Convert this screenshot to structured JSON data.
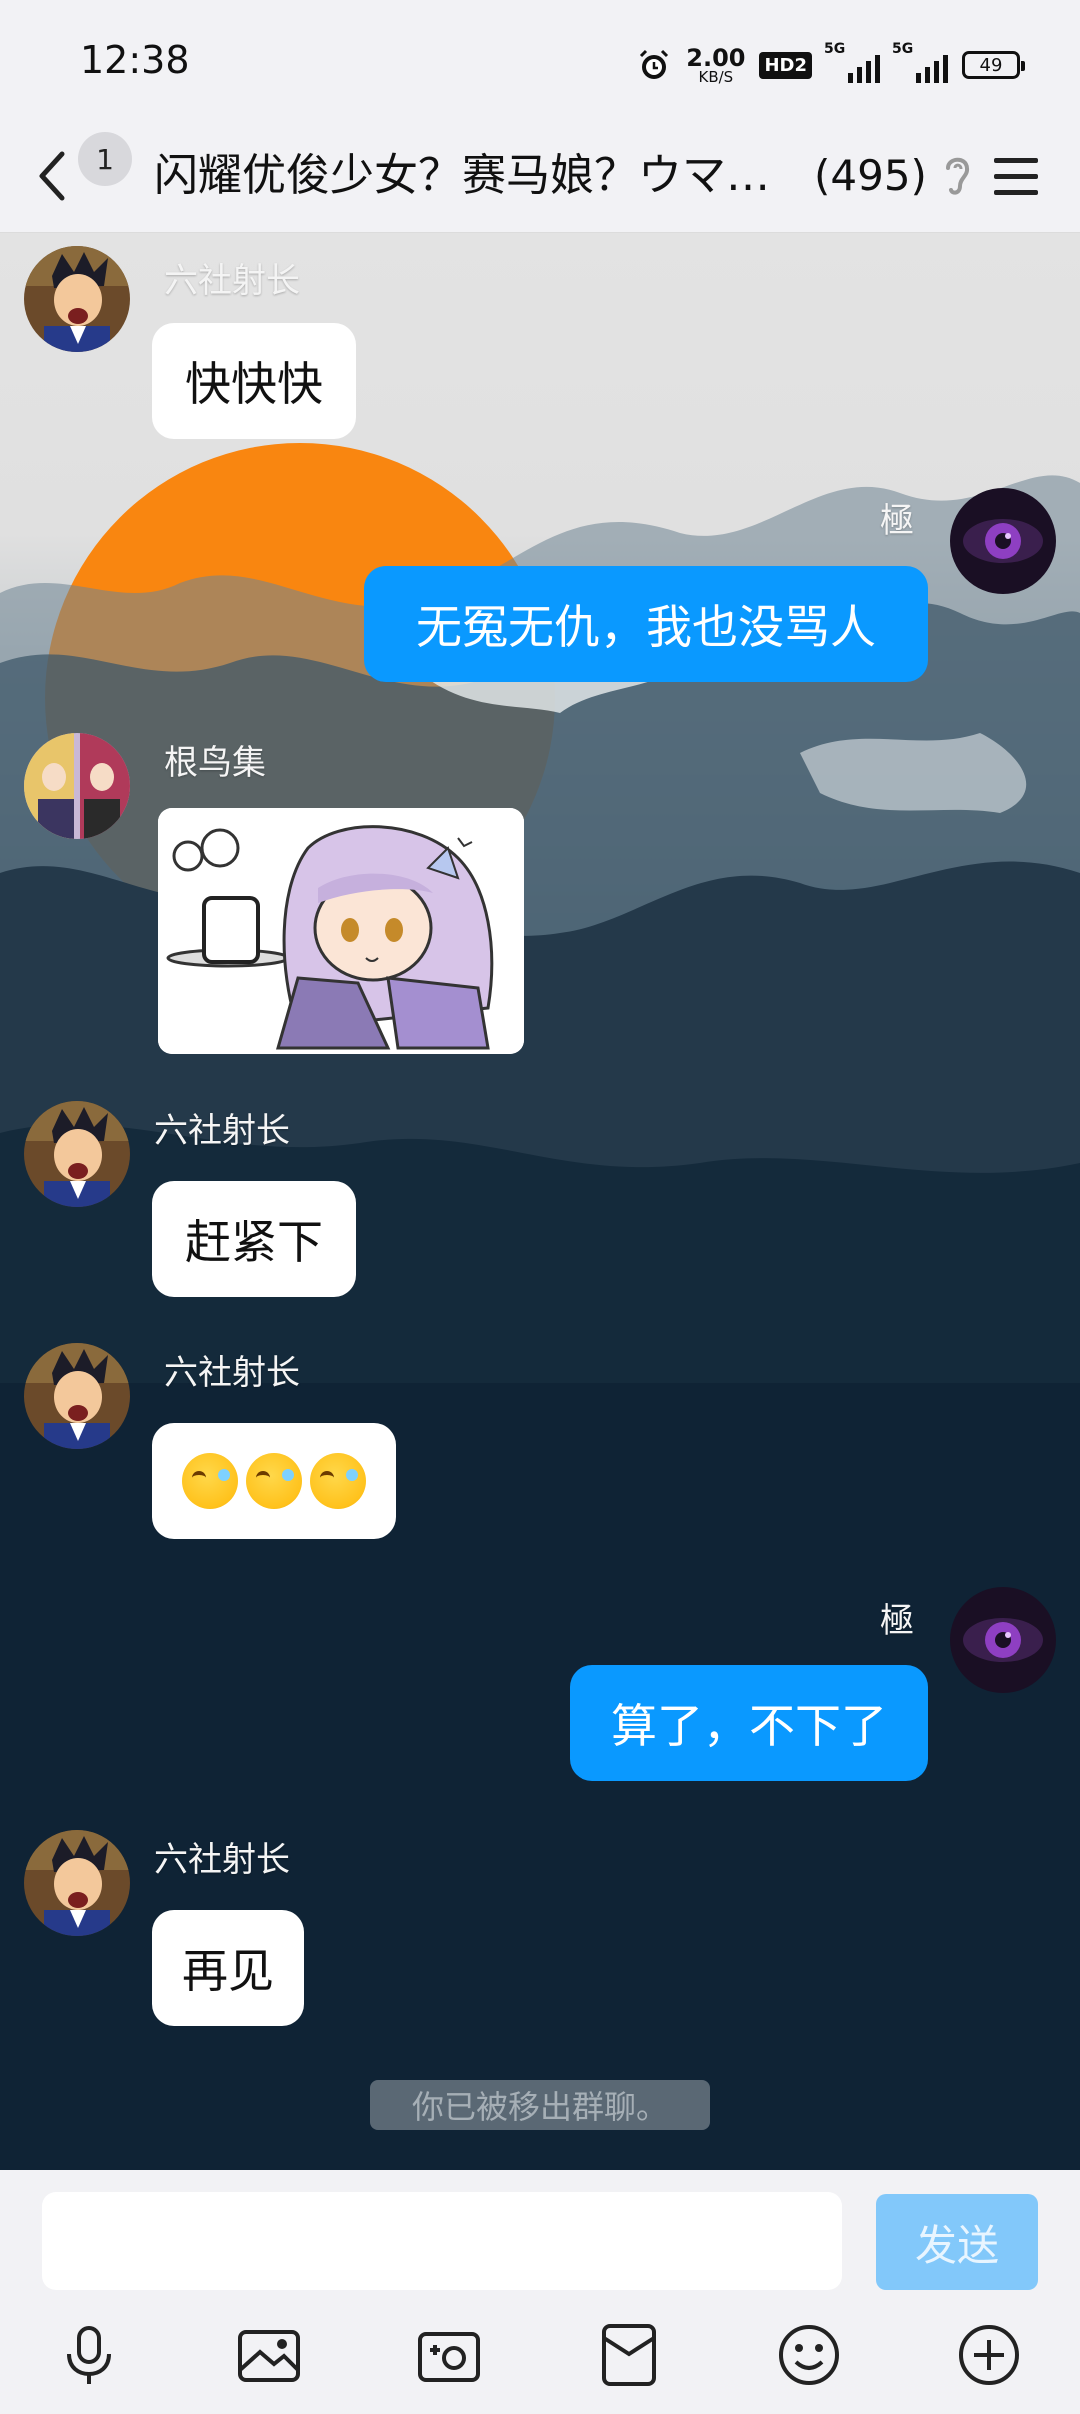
{
  "status_bar": {
    "time": "12:38",
    "net_speed_value": "2.00",
    "net_speed_unit": "KB/S",
    "hd_label": "HD2",
    "signal1_label": "5G",
    "signal2_label": "5G",
    "battery": "49"
  },
  "header": {
    "unread_count": "1",
    "title": "闪耀优俊少女？赛马娘？ウマ…",
    "member_count": "(495)"
  },
  "messages": [
    {
      "sender": "六社射长",
      "text": "快快快",
      "side": "left"
    },
    {
      "sender": "極",
      "text": "无冤无仇，我也没骂人",
      "side": "right"
    },
    {
      "sender": "根鸟集",
      "type": "sticker",
      "side": "left"
    },
    {
      "sender": "六社射长",
      "text": "赶紧下",
      "side": "left"
    },
    {
      "sender": "六社射长",
      "type": "emoji",
      "emoji_name": "laughing-crying-face",
      "count": 3,
      "side": "left"
    },
    {
      "sender": "極",
      "text": "算了，不下了",
      "side": "right"
    },
    {
      "sender": "六社射长",
      "text": "再见",
      "side": "left"
    }
  ],
  "system_notice": "你已被移出群聊。",
  "input": {
    "placeholder": "",
    "send_label": "发送"
  },
  "toolbar": {
    "icons": [
      "microphone-icon",
      "photo-icon",
      "camera-icon",
      "red-packet-icon",
      "emoji-icon",
      "plus-icon"
    ]
  },
  "colors": {
    "outgoing_bubble": "#0a99ff",
    "incoming_bubble": "#ffffff",
    "send_button_disabled": "#82c8fa",
    "bar_background": "#f2f2f5"
  }
}
